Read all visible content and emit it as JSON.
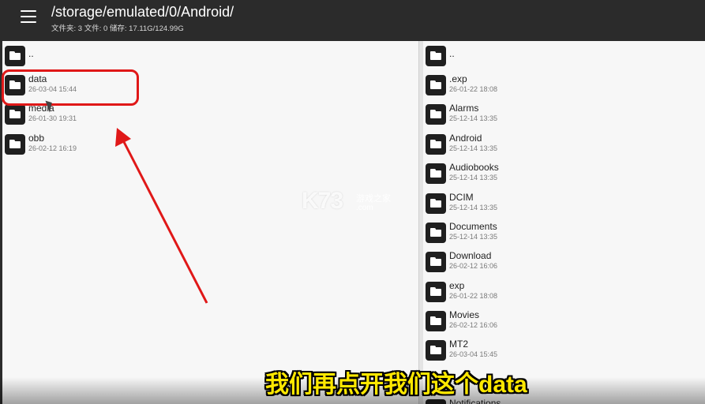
{
  "header": {
    "path": "/storage/emulated/0/Android/",
    "info": "文件夹: 3  文件: 0  储存: 17.11G/124.99G"
  },
  "left_pane": {
    "up_label": "..",
    "items": [
      {
        "name": "data",
        "date": "26-03-04 15:44"
      },
      {
        "name": "media",
        "date": "26-01-30 19:31"
      },
      {
        "name": "obb",
        "date": "26-02-12 16:19"
      }
    ]
  },
  "right_pane": {
    "up_label": "..",
    "items": [
      {
        "name": ".exp",
        "date": "26-01-22 18:08"
      },
      {
        "name": "Alarms",
        "date": "25-12-14 13:35"
      },
      {
        "name": "Android",
        "date": "25-12-14 13:35"
      },
      {
        "name": "Audiobooks",
        "date": "25-12-14 13:35"
      },
      {
        "name": "DCIM",
        "date": "25-12-14 13:35"
      },
      {
        "name": "Documents",
        "date": "25-12-14 13:35"
      },
      {
        "name": "Download",
        "date": "26-02-12 16:06"
      },
      {
        "name": "exp",
        "date": "26-01-22 18:08"
      },
      {
        "name": "Movies",
        "date": "26-02-12 16:06"
      },
      {
        "name": "MT2",
        "date": "26-03-04 15:45"
      },
      {
        "name": "Notifications",
        "date": ""
      }
    ]
  },
  "overlay": {
    "watermark_main": "K73",
    "watermark_sub": "游戏之家",
    "watermark_url": ".com",
    "subtitle": "我们再点开我们这个data"
  },
  "colors": {
    "highlight": "#e01818",
    "subtitle": "#ffe800"
  }
}
